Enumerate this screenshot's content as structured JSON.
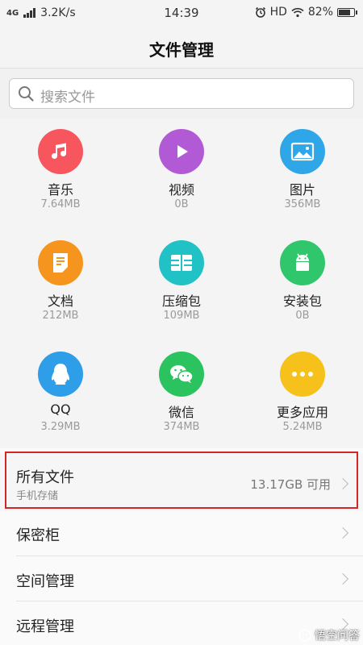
{
  "status_bar": {
    "network": "4G",
    "speed": "3.2K/s",
    "time": "14:39",
    "hd": "HD",
    "battery_pct": "82%",
    "battery_level": 0.82
  },
  "header": {
    "title": "文件管理"
  },
  "search": {
    "placeholder": "搜索文件"
  },
  "categories": [
    {
      "label": "音乐",
      "size": "7.64MB",
      "color": "#f7565f",
      "icon": "music-note-icon"
    },
    {
      "label": "视频",
      "size": "0B",
      "color": "#b25ad6",
      "icon": "play-icon"
    },
    {
      "label": "图片",
      "size": "356MB",
      "color": "#2ea6e8",
      "icon": "image-icon"
    },
    {
      "label": "文档",
      "size": "212MB",
      "color": "#f6951e",
      "icon": "document-icon"
    },
    {
      "label": "压缩包",
      "size": "109MB",
      "color": "#21c2c6",
      "icon": "archive-icon"
    },
    {
      "label": "安装包",
      "size": "0B",
      "color": "#2fc66c",
      "icon": "android-icon"
    },
    {
      "label": "QQ",
      "size": "3.29MB",
      "color": "#2e9ee8",
      "icon": "qq-penguin-icon"
    },
    {
      "label": "微信",
      "size": "374MB",
      "color": "#2ac35f",
      "icon": "wechat-icon"
    },
    {
      "label": "更多应用",
      "size": "5.24MB",
      "color": "#f6c11b",
      "icon": "more-dots-icon"
    }
  ],
  "list": {
    "all_files": {
      "title": "所有文件",
      "subtitle": "手机存储",
      "value": "13.17GB 可用"
    },
    "items": [
      {
        "title": "保密柜"
      },
      {
        "title": "空间管理"
      },
      {
        "title": "远程管理"
      }
    ]
  },
  "watermark": {
    "text": "悟空问答"
  },
  "colors": {
    "highlight": "#d42626",
    "background": "#f4f4f4"
  }
}
